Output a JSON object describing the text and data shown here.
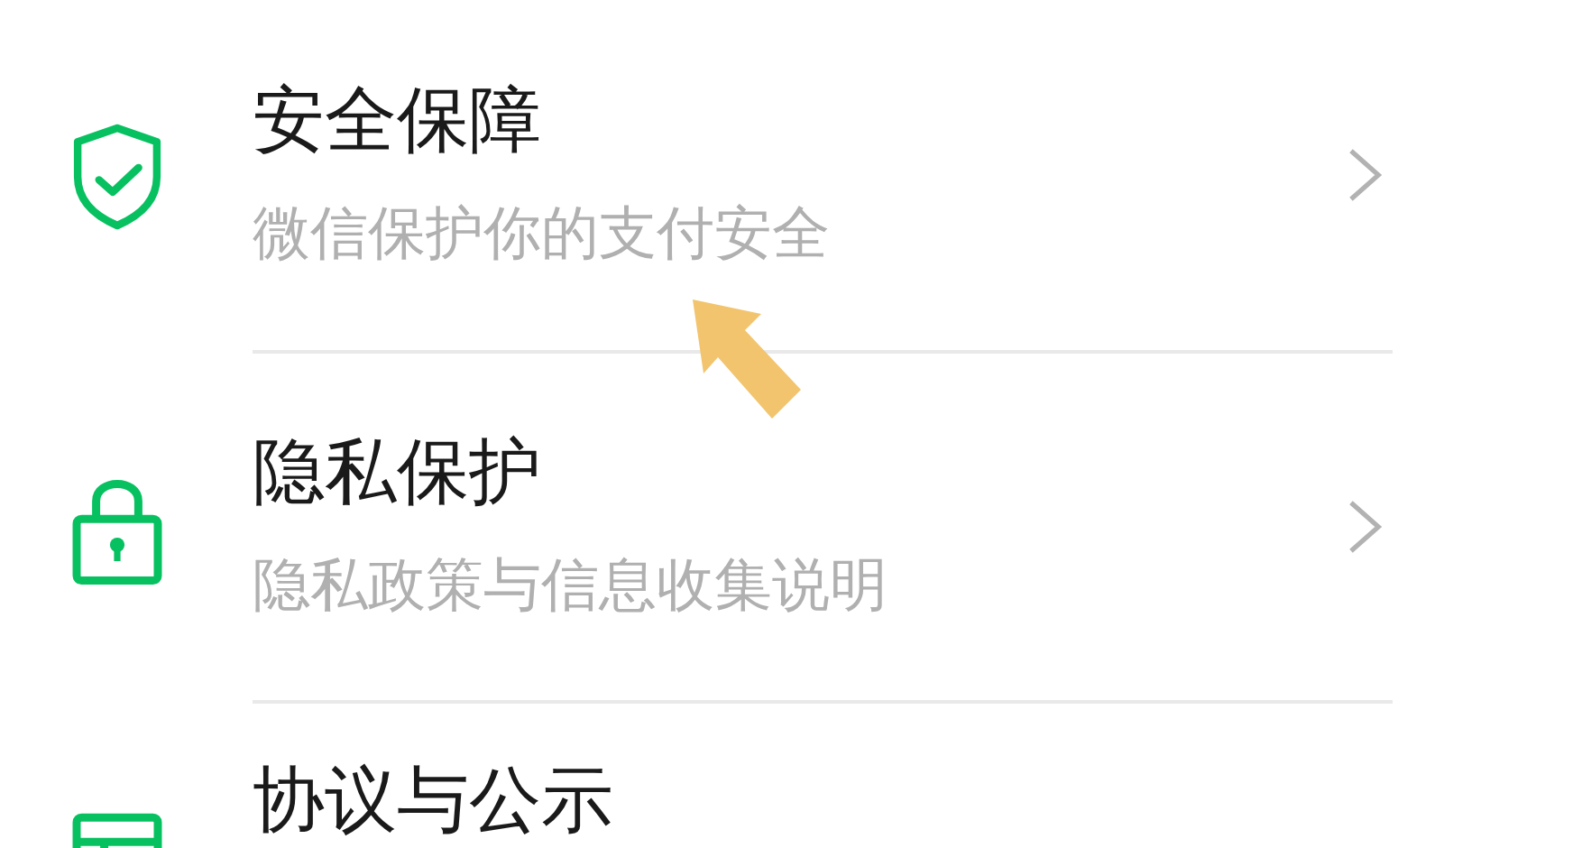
{
  "items": [
    {
      "title": "安全保障",
      "subtitle": "微信保护你的支付安全"
    },
    {
      "title": "隐私保护",
      "subtitle": "隐私政策与信息收集说明"
    },
    {
      "title": "协议与公示"
    }
  ]
}
